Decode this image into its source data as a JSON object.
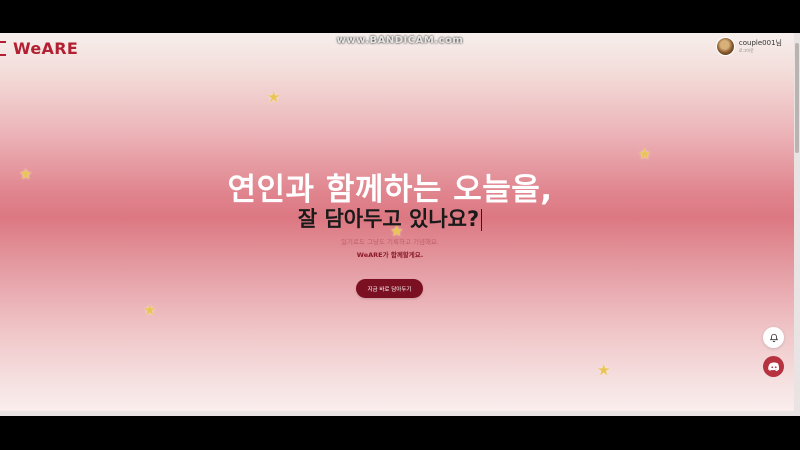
{
  "recorder_watermark": "www.BANDICAM.com",
  "header": {
    "logo_text": "WeARE",
    "user_name": "couple001님",
    "user_sub": "로그아웃"
  },
  "hero": {
    "title_line1": "연인과 함께하는 오늘을,",
    "title_line2": "잘 담아두고 있나요?",
    "desc_line1": "일기로도 그냥도 기록하고 기념해요.",
    "desc_line2": "WeARE가 함께할게요.",
    "cta_label": "지금 바로 담아두기"
  },
  "floating_buttons": {
    "bell_icon": "bell-icon",
    "discord_icon": "discord-icon"
  },
  "colors": {
    "brand": "#b32031",
    "cta": "#7a1021",
    "star": "#e9c558"
  }
}
